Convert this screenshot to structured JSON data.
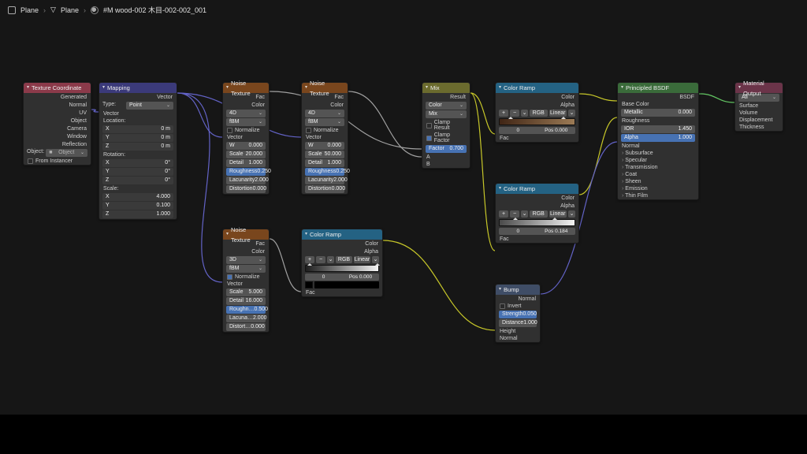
{
  "breadcrumb": {
    "a": "Plane",
    "b": "Plane",
    "c": "#M wood-002 木目-002-002_001"
  },
  "texcoord": {
    "title": "Texture Coordinate",
    "outs": [
      "Generated",
      "Normal",
      "UV",
      "Object",
      "Camera",
      "Window",
      "Reflection"
    ],
    "object_label": "Object:",
    "object_value": "Object",
    "from_instancer": "From Instancer"
  },
  "mapping": {
    "title": "Mapping",
    "out_vector": "Vector",
    "type_label": "Type:",
    "type_value": "Point",
    "in_vector": "Vector",
    "loc_label": "Location:",
    "loc_x": "X",
    "loc_xv": "0 m",
    "loc_y": "Y",
    "loc_yv": "0 m",
    "loc_z": "Z",
    "loc_zv": "0 m",
    "rot_label": "Rotation:",
    "rot_x": "X",
    "rot_xv": "0°",
    "rot_y": "Y",
    "rot_yv": "0°",
    "rot_z": "Z",
    "rot_zv": "0°",
    "sca_label": "Scale:",
    "sca_x": "X",
    "sca_xv": "4.000",
    "sca_y": "Y",
    "sca_yv": "0.100",
    "sca_z": "Z",
    "sca_zv": "1.000"
  },
  "noise1": {
    "title": "Noise Texture",
    "out_fac": "Fac",
    "out_color": "Color",
    "dim": "4D",
    "mode": "fBM",
    "normalize": "Normalize",
    "in_vector": "Vector",
    "w": "W",
    "wv": "0.000",
    "scale": "Scale",
    "scalev": "20.000",
    "detail": "Detail",
    "detailv": "1.000",
    "rough": "Roughness",
    "roughv": "0.250",
    "lacu": "Lacunarity",
    "lacuv": "2.000",
    "dist": "Distortion",
    "distv": "0.000"
  },
  "noise2": {
    "title": "Noise Texture",
    "out_fac": "Fac",
    "out_color": "Color",
    "dim": "4D",
    "mode": "fBM",
    "normalize": "Normalize",
    "in_vector": "Vector",
    "w": "W",
    "wv": "0.000",
    "scale": "Scale",
    "scalev": "50.000",
    "detail": "Detail",
    "detailv": "1.000",
    "rough": "Roughness",
    "roughv": "0.250",
    "lacu": "Lacunarity",
    "lacuv": "2.000",
    "dist": "Distortion",
    "distv": "0.000"
  },
  "noise3": {
    "title": "Noise Texture",
    "out_fac": "Fac",
    "out_color": "Color",
    "dim": "3D",
    "mode": "fBM",
    "normalize": "Normalize",
    "in_vector": "Vector",
    "scale": "Scale",
    "scalev": "5.000",
    "detail": "Detail",
    "detailv": "16.000",
    "rough": "Roughn…",
    "roughv": "0.500",
    "lacu": "Lacuna…",
    "lacuv": "2.000",
    "dist": "Distort…",
    "distv": "0.000"
  },
  "mix": {
    "title": "Mix",
    "out": "Result",
    "type": "Color",
    "blend": "Mix",
    "clamp_result": "Clamp Result",
    "clamp_factor": "Clamp Factor",
    "factor": "Factor",
    "factorv": "0.700",
    "a": "A",
    "b": "B"
  },
  "ramp1": {
    "title": "Color Ramp",
    "out_color": "Color",
    "out_alpha": "Alpha",
    "interp": "RGB",
    "mode": "Linear",
    "idx": "0",
    "pos_lbl": "Pos",
    "pos": "0.000",
    "fac": "Fac",
    "grad_start": "#402515",
    "grad_end": "#9b7a55"
  },
  "ramp2": {
    "title": "Color Ramp",
    "out_color": "Color",
    "out_alpha": "Alpha",
    "interp": "RGB",
    "mode": "Linear",
    "idx": "0",
    "pos_lbl": "Pos",
    "pos": "0.184",
    "fac": "Fac",
    "grad_start": "#4a4a4a",
    "grad_end": "#f3f3f3"
  },
  "ramp3": {
    "title": "Color Ramp",
    "out_color": "Color",
    "out_alpha": "Alpha",
    "interp": "RGB",
    "mode": "Linear",
    "idx": "0",
    "pos_lbl": "Pos",
    "pos": "0.000",
    "fac": "Fac",
    "grad_start": "#1e1e1e",
    "grad_end": "#f3f3f3",
    "swatch": "#000000"
  },
  "bump": {
    "title": "Bump",
    "out": "Normal",
    "invert": "Invert",
    "strength": "Strength",
    "strengthv": "0.050",
    "distance": "Distance",
    "distancev": "1.000",
    "height": "Height",
    "normal": "Normal"
  },
  "bsdf": {
    "title": "Principled BSDF",
    "out": "BSDF",
    "base": "Base Color",
    "metallic": "Metallic",
    "metallicv": "0.000",
    "rough": "Roughness",
    "ior": "IOR",
    "iorv": "1.450",
    "alpha": "Alpha",
    "alphav": "1.000",
    "normal": "Normal",
    "sects": [
      "Subsurface",
      "Specular",
      "Transmission",
      "Coat",
      "Sheen",
      "Emission",
      "Thin Film"
    ]
  },
  "out": {
    "title": "Material Output",
    "target": "All",
    "surface": "Surface",
    "volume": "Volume",
    "disp": "Displacement",
    "thick": "Thickness"
  }
}
